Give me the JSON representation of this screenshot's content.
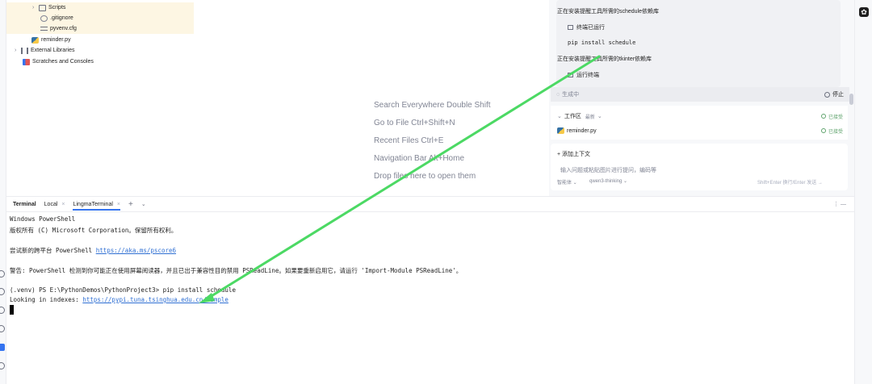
{
  "project_tree": {
    "items": [
      {
        "label": "Scripts",
        "icon": "folder-icon",
        "chevron": "›"
      },
      {
        "label": ".gitignore",
        "icon": "gitignore-icon"
      },
      {
        "label": "pyvenv.cfg",
        "icon": "config-file-icon"
      },
      {
        "label": "reminder.py",
        "icon": "python-file-icon"
      },
      {
        "label": "External Libraries",
        "icon": "library-icon",
        "chevron": "›"
      },
      {
        "label": "Scratches and Consoles",
        "icon": "scratches-icon"
      }
    ]
  },
  "editor": {
    "hints": [
      "Search Everywhere Double Shift",
      "Go to File Ctrl+Shift+N",
      "Recent Files Ctrl+E",
      "Navigation Bar Alt+Home",
      "Drop files here to open them"
    ]
  },
  "ai_panel": {
    "step1": "正在安装提醒工具所需的schedule依赖库",
    "terminal_ran": "终端已运行",
    "command": "pip install schedule",
    "step2": "正在安装提醒工具所需的tkinter依赖库",
    "running_terminal": "运行终端",
    "generating": "生成中",
    "stop": "停止",
    "workspace_label": "工作区",
    "workspace_filter": "最新",
    "accepted1": "已接受",
    "file": "reminder.py",
    "accepted2": "已接受",
    "add_context": "添加上下文",
    "input_placeholder": "输入问题或粘贴图片进行提问，编码等",
    "mode": "智能体",
    "model": "qwen3-thinking",
    "send_hint": "Shift+Enter 换行/Enter 发送"
  },
  "terminal": {
    "title": "Terminal",
    "tabs": [
      "Local",
      "LingmaTerminal"
    ],
    "add": "+",
    "more": "⌄",
    "tools": "⋮  —",
    "lines": {
      "l1": "Windows PowerShell",
      "l2": "版权所有 (C) Microsoft Corporation。保留所有权利。",
      "l3_prefix": "尝试新的跨平台 PowerShell ",
      "l3_link": "https://aka.ms/pscore6",
      "l4": "警告: PowerShell 检测到你可能正在使用屏幕阅读器，并且已出于兼容性目的禁用 PSReadLine。如果要重新启用它，请运行 'Import-Module PSReadLine'。",
      "l5": "(.venv) PS E:\\PythonDemos\\PythonProject3> pip install schedule",
      "l6_prefix": "Looking in indexes: ",
      "l6_link": "https://pypi.tuna.tsinghua.edu.cn/simple"
    }
  },
  "colors": {
    "accent": "#3574f0",
    "arrow": "#4cd964",
    "link": "#2f6fd3",
    "accepted": "#5fa36d"
  }
}
